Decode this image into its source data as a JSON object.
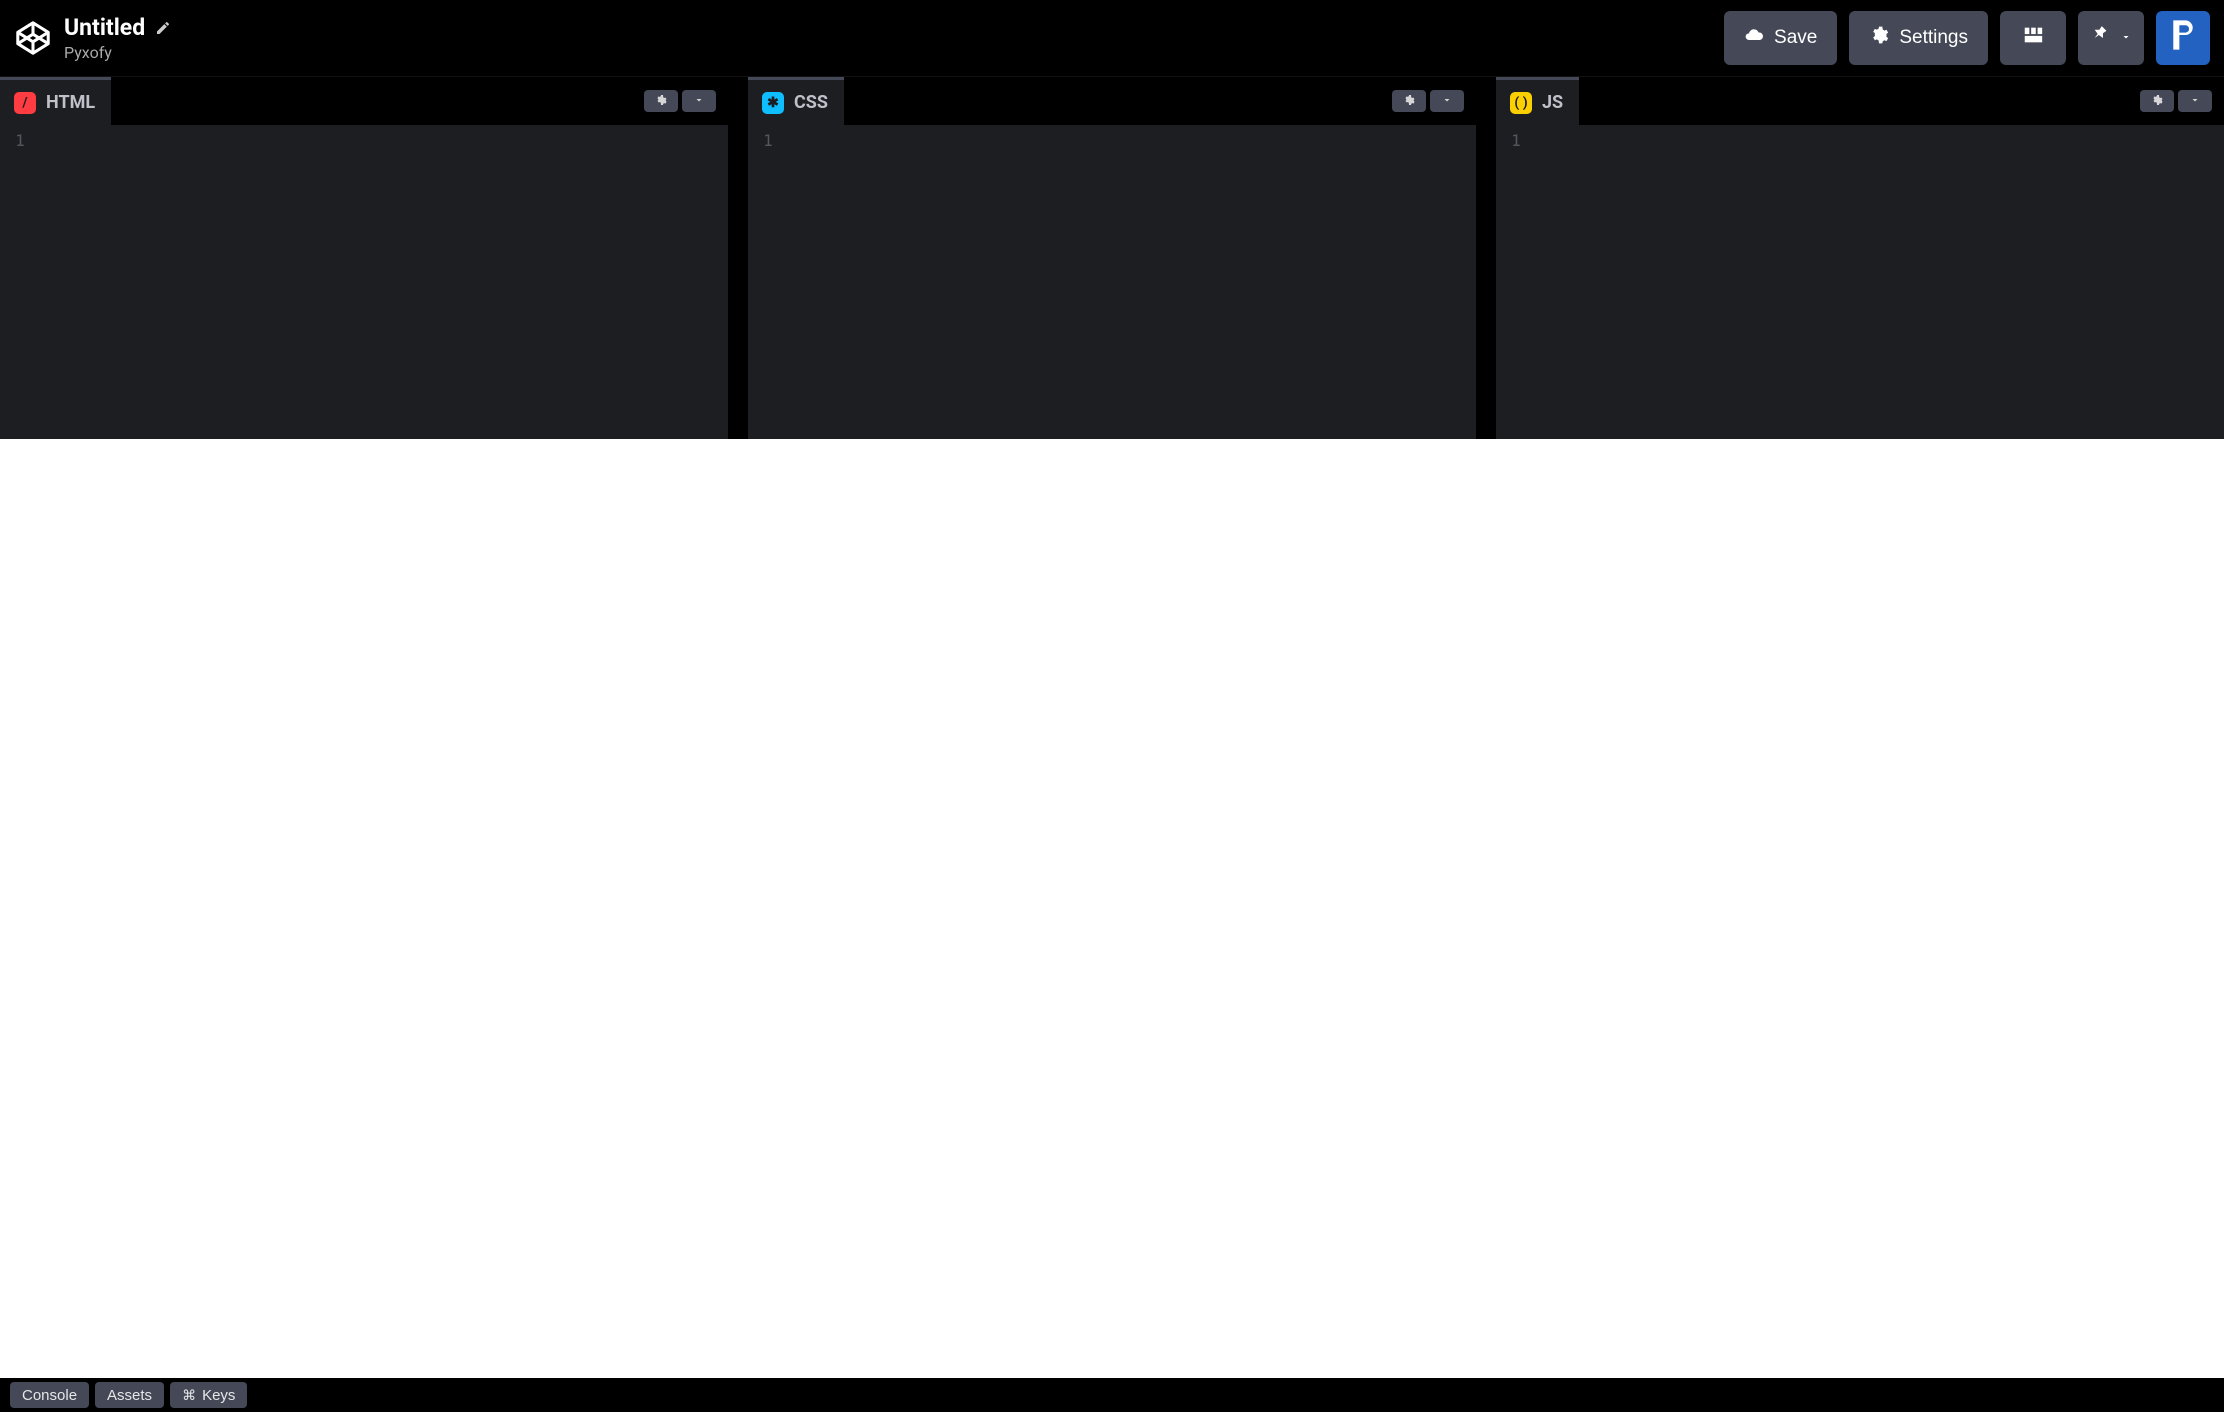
{
  "header": {
    "title": "Untitled",
    "author": "Pyxofy",
    "save_label": "Save",
    "settings_label": "Settings"
  },
  "panes": {
    "html": {
      "label": "HTML",
      "line_start": "1"
    },
    "css": {
      "label": "CSS",
      "line_start": "1"
    },
    "js": {
      "label": "JS",
      "line_start": "1"
    }
  },
  "footer": {
    "console_label": "Console",
    "assets_label": "Assets",
    "keys_label": "Keys",
    "keys_prefix": "⌘"
  }
}
